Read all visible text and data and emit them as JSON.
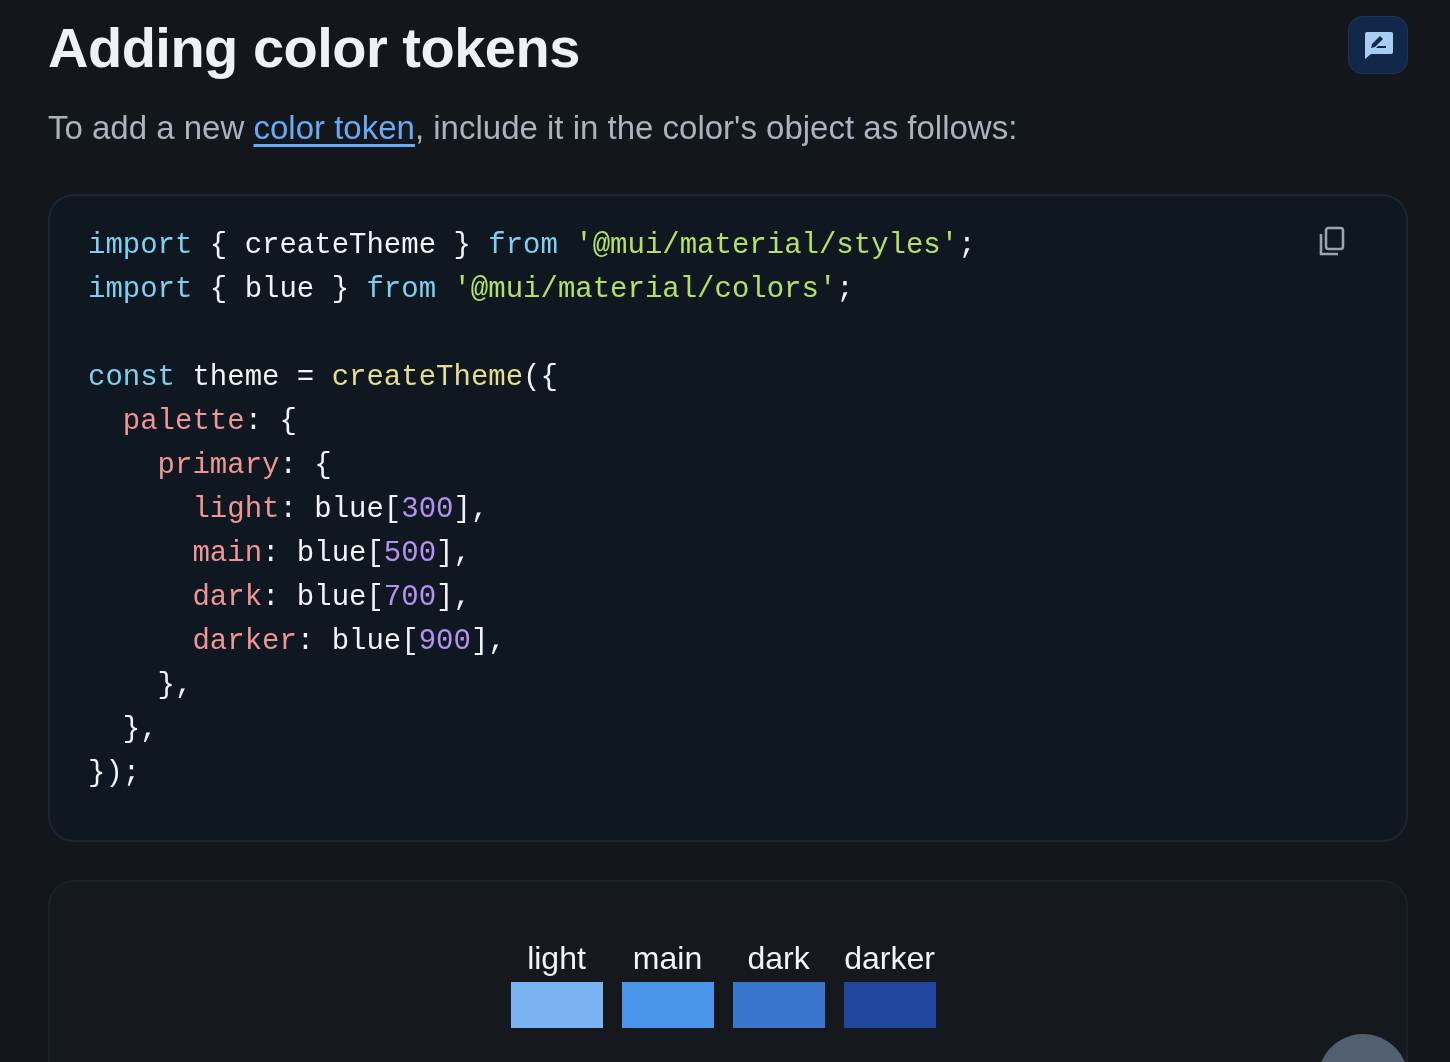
{
  "title": "Adding color tokens",
  "intro": {
    "before": "To add a new ",
    "link": "color token",
    "after": ", include it in the color's object as follows:"
  },
  "code": [
    {
      "tokens": [
        {
          "kind": "keyword",
          "text": "import"
        },
        {
          "kind": "plain",
          "text": " { createTheme } "
        },
        {
          "kind": "keyword",
          "text": "from "
        },
        {
          "kind": "string",
          "text": "'@mui/material/styles'"
        },
        {
          "kind": "plain",
          "text": ";"
        }
      ]
    },
    {
      "tokens": [
        {
          "kind": "keyword",
          "text": "import"
        },
        {
          "kind": "plain",
          "text": " { blue } "
        },
        {
          "kind": "keyword",
          "text": "from "
        },
        {
          "kind": "string",
          "text": "'@mui/material/colors'"
        },
        {
          "kind": "plain",
          "text": ";"
        }
      ]
    },
    {
      "gap_before": true,
      "tokens": [
        {
          "kind": "keyword",
          "text": "const"
        },
        {
          "kind": "plain",
          "text": " theme = "
        },
        {
          "kind": "function",
          "text": "createTheme"
        },
        {
          "kind": "plain",
          "text": "({"
        }
      ]
    },
    {
      "tokens": [
        {
          "kind": "property",
          "text": "  palette"
        },
        {
          "kind": "plain",
          "text": ": {"
        }
      ]
    },
    {
      "tokens": [
        {
          "kind": "property",
          "text": "    primary"
        },
        {
          "kind": "plain",
          "text": ": {"
        }
      ]
    },
    {
      "tokens": [
        {
          "kind": "property",
          "text": "      light"
        },
        {
          "kind": "plain",
          "text": ": blue["
        },
        {
          "kind": "number",
          "text": "300"
        },
        {
          "kind": "plain",
          "text": "],"
        }
      ]
    },
    {
      "tokens": [
        {
          "kind": "property",
          "text": "      main"
        },
        {
          "kind": "plain",
          "text": ": blue["
        },
        {
          "kind": "number",
          "text": "500"
        },
        {
          "kind": "plain",
          "text": "],"
        }
      ]
    },
    {
      "tokens": [
        {
          "kind": "property",
          "text": "      dark"
        },
        {
          "kind": "plain",
          "text": ": blue["
        },
        {
          "kind": "number",
          "text": "700"
        },
        {
          "kind": "plain",
          "text": "],"
        }
      ]
    },
    {
      "tokens": [
        {
          "kind": "property",
          "text": "      darker"
        },
        {
          "kind": "plain",
          "text": ": blue["
        },
        {
          "kind": "number",
          "text": "900"
        },
        {
          "kind": "plain",
          "text": "],"
        }
      ]
    },
    {
      "tokens": [
        {
          "kind": "plain",
          "text": "    },"
        }
      ]
    },
    {
      "tokens": [
        {
          "kind": "plain",
          "text": "  },"
        }
      ]
    },
    {
      "tokens": [
        {
          "kind": "plain",
          "text": "});"
        }
      ]
    }
  ],
  "swatches": [
    {
      "label": "light",
      "color": "#7bb3f1"
    },
    {
      "label": "main",
      "color": "#4a96ec"
    },
    {
      "label": "dark",
      "color": "#3a75cc"
    },
    {
      "label": "darker",
      "color": "#2146a0"
    }
  ]
}
